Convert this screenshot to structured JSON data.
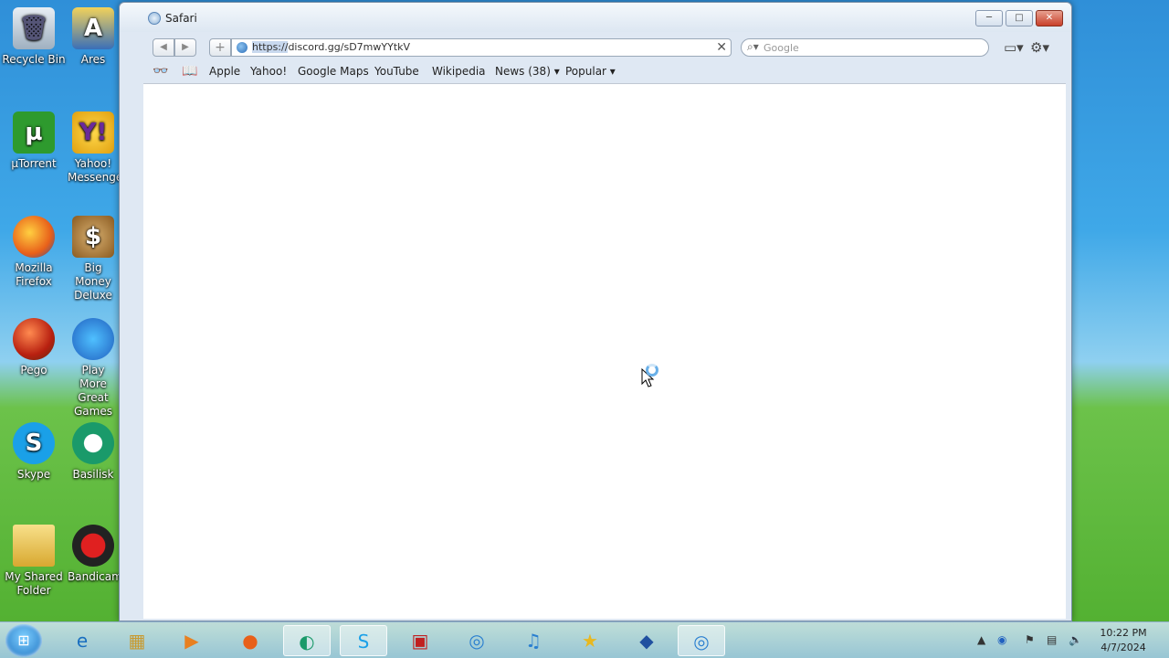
{
  "desktop": {
    "icons": [
      {
        "label": "Recycle Bin",
        "icon": "recycle-bin-icon"
      },
      {
        "label": "Ares",
        "icon": "ares-icon"
      },
      {
        "label": "µTorrent",
        "icon": "utorrent-icon"
      },
      {
        "label": "Yahoo! Messenger",
        "icon": "yahoo-messenger-icon"
      },
      {
        "label": "Mozilla Firefox",
        "icon": "firefox-icon"
      },
      {
        "label": "Big Money Deluxe",
        "icon": "big-money-icon"
      },
      {
        "label": "Pego",
        "icon": "pego-icon"
      },
      {
        "label": "Play More Great Games",
        "icon": "play-more-games-icon"
      },
      {
        "label": "Skype",
        "icon": "skype-icon"
      },
      {
        "label": "Basilisk",
        "icon": "basilisk-icon"
      },
      {
        "label": "My Shared Folder",
        "icon": "folder-icon"
      },
      {
        "label": "Bandicam",
        "icon": "bandicam-icon"
      }
    ]
  },
  "window": {
    "title": "Safari",
    "controls": {
      "minimize": "─",
      "maximize": "□",
      "close": "✕"
    }
  },
  "toolbar": {
    "back": "◀",
    "forward": "▶",
    "add": "+",
    "url_selected": "https://",
    "url_rest": "discord.gg/sD7mwYYtkV",
    "clear": "✕",
    "search_placeholder": "Google"
  },
  "bookmarks": {
    "items": [
      "Apple",
      "Yahoo!",
      "Google Maps",
      "YouTube",
      "Wikipedia",
      "News (38) ▾",
      "Popular ▾"
    ]
  },
  "taskbar": {
    "clock_time": "10:22 PM",
    "clock_date": "4/7/2024"
  },
  "colors": {
    "titlebar": "#dfe8f3",
    "taskbar": "#a0c8e6",
    "desktop_sky": "#3fa8e8",
    "desktop_grass": "#4fae2e"
  }
}
